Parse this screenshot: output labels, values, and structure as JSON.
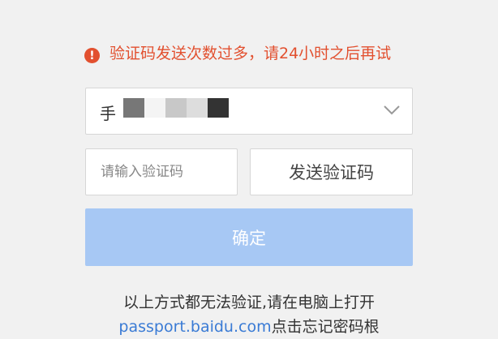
{
  "error": {
    "icon": "exclamation-circle-icon",
    "message": "验证码发送次数过多，请24小时之后再试",
    "color": "#e2502f"
  },
  "phone": {
    "prefix": "手",
    "dropdown_icon": "chevron-down-icon"
  },
  "code_input": {
    "placeholder": "请输入验证码"
  },
  "send_button": {
    "label": "发送验证码"
  },
  "confirm_button": {
    "label": "确定",
    "color": "#a7c8f4"
  },
  "footer": {
    "line1": "以上方式都无法验证,请在电脑上打开",
    "link": "passport.baidu.com",
    "line2_suffix": "点击忘记密码根"
  }
}
